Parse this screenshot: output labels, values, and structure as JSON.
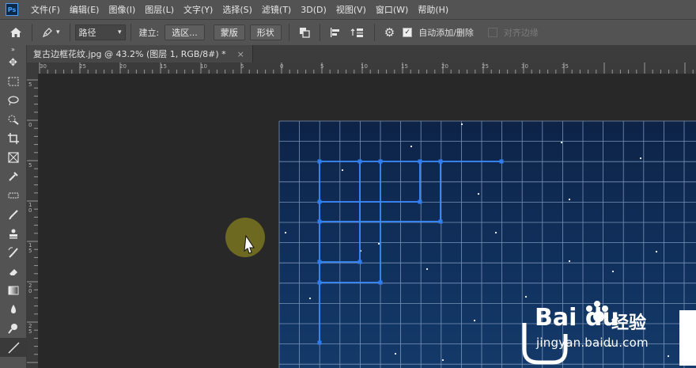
{
  "app": {
    "logo": "Ps"
  },
  "menu": [
    "文件(F)",
    "编辑(E)",
    "图像(I)",
    "图层(L)",
    "文字(Y)",
    "选择(S)",
    "滤镜(T)",
    "3D(D)",
    "视图(V)",
    "窗口(W)",
    "帮助(H)"
  ],
  "options": {
    "mode_value": "路径",
    "create_label": "建立:",
    "selection_button": "选区...",
    "mask_button": "蒙版",
    "shape_button": "形状",
    "auto_add_delete_label": "自动添加/删除",
    "auto_add_delete_checked": true,
    "align_edges_label": "对齐边缘",
    "align_edges_checked": false
  },
  "document": {
    "tab_title": "复古边框花纹.jpg @ 43.2% (图层 1, RGB/8#) *",
    "close": "×"
  },
  "rulers": {
    "horizontal": [
      "30",
      "25",
      "20",
      "15",
      "10",
      "5",
      "0",
      "5",
      "10",
      "15",
      "20",
      "25",
      "30",
      "35"
    ],
    "vertical": [
      "5",
      "0",
      "5",
      "1 0",
      "1 5",
      "2 0",
      "2 5"
    ]
  },
  "watermark": {
    "logo_text": "Bai du",
    "site_cn": "经验",
    "url": "jingyan.baidu.com"
  },
  "colors": {
    "ui_dark": "#535353",
    "canvas": "#282828",
    "image_bg": "#0f2a52",
    "path": "#3a8bff",
    "cursor_highlight": "#7a7420"
  },
  "icons": [
    "home-icon",
    "pen-tool-icon",
    "path-operations-icon",
    "path-alignment-icon",
    "path-arrangement-icon",
    "gear-icon"
  ]
}
